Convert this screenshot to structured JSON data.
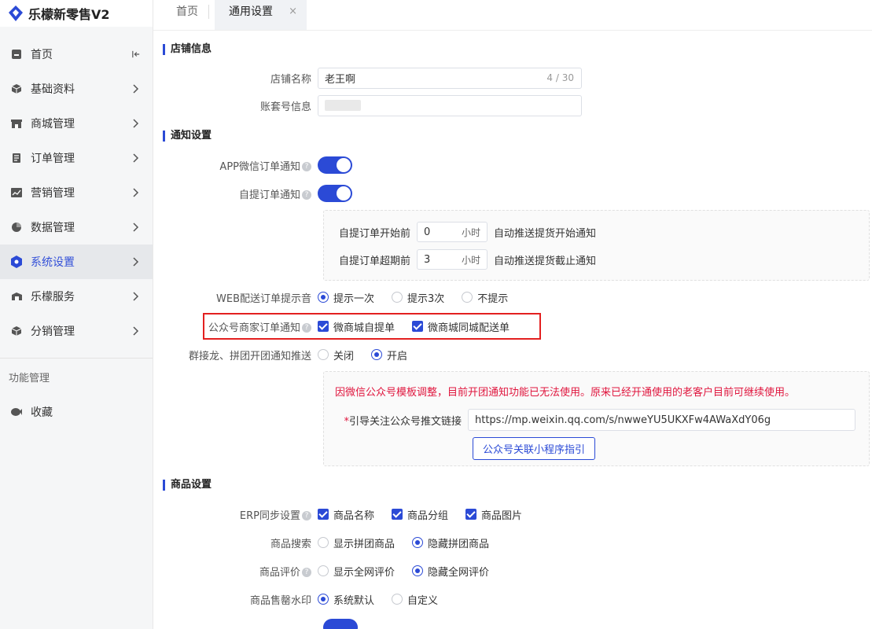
{
  "app": {
    "title": "乐檬新零售V2"
  },
  "sidebar": {
    "items": [
      {
        "label": "首页",
        "icon": "home-icon",
        "active": false
      },
      {
        "label": "基础资料",
        "icon": "cube-icon",
        "active": false
      },
      {
        "label": "商城管理",
        "icon": "shop-icon",
        "active": false
      },
      {
        "label": "订单管理",
        "icon": "order-icon",
        "active": false
      },
      {
        "label": "营销管理",
        "icon": "chart-icon",
        "active": false
      },
      {
        "label": "数据管理",
        "icon": "pie-icon",
        "active": false
      },
      {
        "label": "系统设置",
        "icon": "gear-icon",
        "active": true
      },
      {
        "label": "乐檬服务",
        "icon": "service-icon",
        "active": false
      },
      {
        "label": "分销管理",
        "icon": "cube-icon",
        "active": false
      }
    ],
    "group_label": "功能管理",
    "favorites_label": "收藏"
  },
  "tabs": {
    "home": "首页",
    "current": "通用设置",
    "close": "×"
  },
  "store_info": {
    "title": "店铺信息",
    "name_label": "店铺名称",
    "name_value": "老王啊",
    "name_counter": "4 / 30",
    "account_label": "账套号信息"
  },
  "notify": {
    "title": "通知设置",
    "app_wechat_label": "APP微信订单通知",
    "self_pickup_label": "自提订单通知",
    "before_start_label": "自提订单开始前",
    "before_start_value": "0",
    "before_start_unit": "小时",
    "before_start_desc": "自动推送提货开始通知",
    "before_expire_label": "自提订单超期前",
    "before_expire_value": "3",
    "before_expire_unit": "小时",
    "before_expire_desc": "自动推送提货截止通知",
    "web_sound_label": "WEB配送订单提示音",
    "web_sound_options": [
      "提示一次",
      "提示3次",
      "不提示"
    ],
    "web_sound_selected": 0,
    "mp_label": "公众号商家订单通知",
    "mp_options": [
      "微商城自提单",
      "微商城同城配送单"
    ],
    "group_label": "群接龙、拼团开团通知推送",
    "group_options": [
      "关闭",
      "开启"
    ],
    "group_selected": 1,
    "notice": "因微信公众号模板调整，目前开团通知功能已无法使用。原来已经开通使用的老客户目前可继续使用。",
    "link_label": "引导关注公众号推文链接",
    "link_required_mark": "*",
    "link_value": "https://mp.weixin.qq.com/s/nwweYU5UKXFw4AWaXdY06g",
    "guide_button": "公众号关联小程序指引"
  },
  "goods": {
    "title": "商品设置",
    "erp_label": "ERP同步设置",
    "erp_options": [
      "商品名称",
      "商品分组",
      "商品图片"
    ],
    "search_label": "商品搜索",
    "search_options": [
      "显示拼团商品",
      "隐藏拼团商品"
    ],
    "search_selected": 1,
    "review_label": "商品评价",
    "review_options": [
      "显示全网评价",
      "隐藏全网评价"
    ],
    "review_selected": 1,
    "watermark_label": "商品售罄水印",
    "watermark_options": [
      "系统默认",
      "自定义"
    ],
    "watermark_selected": 0
  },
  "help_mark": "?",
  "colors": {
    "accent": "#2b4ad6",
    "warning": "#e0163e",
    "highlight": "#e32020"
  }
}
